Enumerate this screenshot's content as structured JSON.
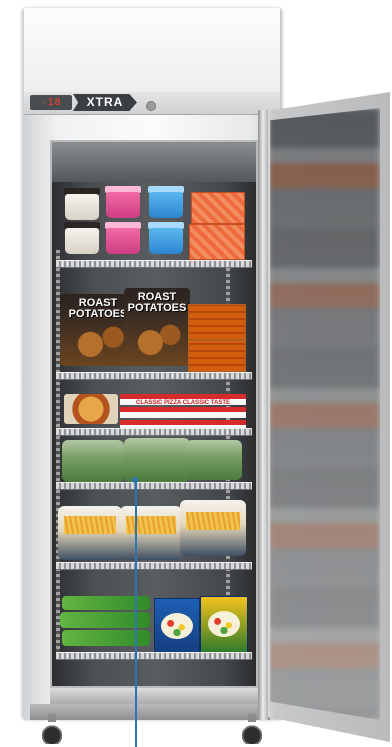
{
  "display": {
    "temperature": "-18"
  },
  "brand": {
    "name": "XTRA"
  },
  "products": {
    "roast_bag_1": "ROAST POTATOES",
    "roast_bag_2": "ROAST POTATOES",
    "pizza_label": "CLASSIC PIZZA CLASSIC TASTE"
  },
  "colors": {
    "cabinet": "#f1f2f3",
    "interior": "#4c4f52",
    "accent_pointer": "#2e74b5",
    "brand_badge": "#3b3e42"
  },
  "icons": [
    "lock-icon",
    "castor-wheel-icon"
  ]
}
